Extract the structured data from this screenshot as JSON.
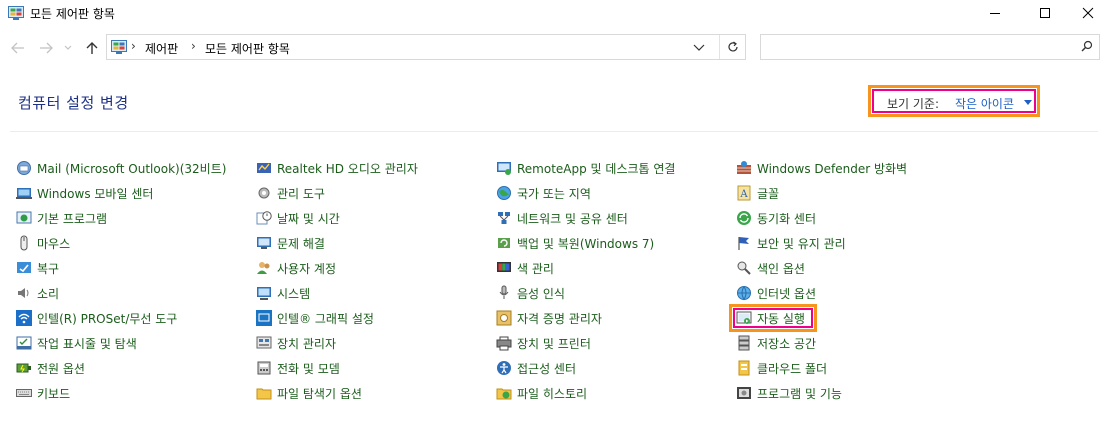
{
  "window": {
    "title": "모든 제어판 항목"
  },
  "address": {
    "crumbs": [
      "제어판",
      "모든 제어판 항목"
    ]
  },
  "search": {
    "placeholder": ""
  },
  "header": {
    "title": "컴퓨터 설정 변경",
    "view_by_label": "보기 기준:",
    "view_by_value": "작은 아이콘"
  },
  "colors": {
    "link_green": "#1b5c1b",
    "title_blue": "#1e3287",
    "highlight_orange": "#f7941d",
    "highlight_pink": "#ec008c"
  },
  "items": {
    "col1": [
      {
        "label": "Mail (Microsoft Outlook)(32비트)",
        "icon": "mail-icon"
      },
      {
        "label": "Windows 모바일 센터",
        "icon": "mobility-center-icon"
      },
      {
        "label": "기본 프로그램",
        "icon": "default-programs-icon"
      },
      {
        "label": "마우스",
        "icon": "mouse-icon"
      },
      {
        "label": "복구",
        "icon": "recovery-icon"
      },
      {
        "label": "소리",
        "icon": "sound-icon"
      },
      {
        "label": "인텔(R) PROSet/무선 도구",
        "icon": "wireless-icon"
      },
      {
        "label": "작업 표시줄 및 탐색",
        "icon": "taskbar-icon"
      },
      {
        "label": "전원 옵션",
        "icon": "power-icon"
      },
      {
        "label": "키보드",
        "icon": "keyboard-icon"
      }
    ],
    "col2": [
      {
        "label": "Realtek HD 오디오 관리자",
        "icon": "realtek-audio-icon"
      },
      {
        "label": "관리 도구",
        "icon": "admin-tools-icon"
      },
      {
        "label": "날짜 및 시간",
        "icon": "date-time-icon"
      },
      {
        "label": "문제 해결",
        "icon": "troubleshoot-icon"
      },
      {
        "label": "사용자 계정",
        "icon": "user-accounts-icon"
      },
      {
        "label": "시스템",
        "icon": "system-icon"
      },
      {
        "label": "인텔® 그래픽 설정",
        "icon": "intel-graphics-icon"
      },
      {
        "label": "장치 관리자",
        "icon": "device-manager-icon"
      },
      {
        "label": "전화 및 모뎀",
        "icon": "phone-modem-icon"
      },
      {
        "label": "파일 탐색기 옵션",
        "icon": "folder-options-icon"
      }
    ],
    "col3": [
      {
        "label": "RemoteApp 및 데스크톱 연결",
        "icon": "remoteapp-icon"
      },
      {
        "label": "국가 또는 지역",
        "icon": "region-icon"
      },
      {
        "label": "네트워크 및 공유 센터",
        "icon": "network-icon"
      },
      {
        "label": "백업 및 복원(Windows 7)",
        "icon": "backup-icon"
      },
      {
        "label": "색 관리",
        "icon": "color-management-icon"
      },
      {
        "label": "음성 인식",
        "icon": "speech-icon"
      },
      {
        "label": "자격 증명 관리자",
        "icon": "credential-icon"
      },
      {
        "label": "장치 및 프린터",
        "icon": "devices-printers-icon"
      },
      {
        "label": "접근성 센터",
        "icon": "ease-of-access-icon"
      },
      {
        "label": "파일 히스토리",
        "icon": "file-history-icon"
      }
    ],
    "col4": [
      {
        "label": "Windows Defender 방화벽",
        "icon": "firewall-icon"
      },
      {
        "label": "글꼴",
        "icon": "fonts-icon"
      },
      {
        "label": "동기화 센터",
        "icon": "sync-center-icon"
      },
      {
        "label": "보안 및 유지 관리",
        "icon": "security-flag-icon"
      },
      {
        "label": "색인 옵션",
        "icon": "indexing-icon"
      },
      {
        "label": "인터넷 옵션",
        "icon": "internet-options-icon"
      },
      {
        "label": "자동 실행",
        "icon": "autoplay-icon"
      },
      {
        "label": "저장소 공간",
        "icon": "storage-spaces-icon"
      },
      {
        "label": "클라우드 폴더",
        "icon": "work-folders-icon"
      },
      {
        "label": "프로그램 및 기능",
        "icon": "programs-features-icon"
      }
    ]
  }
}
